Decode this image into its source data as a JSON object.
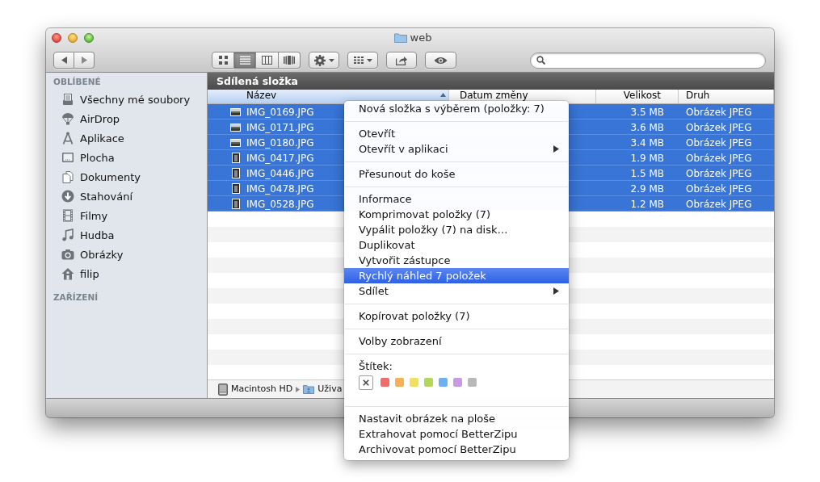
{
  "window": {
    "title": "web"
  },
  "toolbar": {
    "view_modes": [
      {
        "kind": "icons",
        "selected": false
      },
      {
        "kind": "list",
        "selected": true
      },
      {
        "kind": "columns",
        "selected": false
      },
      {
        "kind": "coverflow",
        "selected": false
      }
    ]
  },
  "sidebar": {
    "sections": [
      {
        "heading": "OBLÍBENÉ",
        "items": [
          {
            "kind": "allfiles",
            "label": "Všechny mé soubory",
            "selected": false
          },
          {
            "kind": "airdrop",
            "label": "AirDrop",
            "selected": false
          },
          {
            "kind": "apps",
            "label": "Aplikace",
            "selected": false
          },
          {
            "kind": "desktop",
            "label": "Plocha",
            "selected": false
          },
          {
            "kind": "documents",
            "label": "Dokumenty",
            "selected": false
          },
          {
            "kind": "downloads",
            "label": "Stahování",
            "selected": false
          },
          {
            "kind": "movies",
            "label": "Filmy",
            "selected": false
          },
          {
            "kind": "music",
            "label": "Hudba",
            "selected": false
          },
          {
            "kind": "pictures",
            "label": "Obrázky",
            "selected": false
          },
          {
            "kind": "home",
            "label": "filip",
            "selected": false
          }
        ]
      },
      {
        "heading": "ZAŘÍZENÍ"
      }
    ]
  },
  "browser": {
    "title": "Sdílená složka",
    "columns": [
      {
        "label": "Název",
        "sorted": true
      },
      {
        "label": "Datum změny",
        "sorted": false
      },
      {
        "label": "Velikost",
        "sorted": false
      },
      {
        "label": "Druh",
        "sorted": false
      }
    ],
    "rows": [
      {
        "kind": "landscape",
        "name": "IMG_0169.JPG",
        "size": "3.5 MB",
        "type": "Obrázek JPEG",
        "selected": true
      },
      {
        "kind": "landscape",
        "name": "IMG_0171.JPG",
        "size": "3.6 MB",
        "type": "Obrázek JPEG",
        "selected": true
      },
      {
        "kind": "landscape",
        "name": "IMG_0180.JPG",
        "size": "3.4 MB",
        "type": "Obrázek JPEG",
        "selected": true
      },
      {
        "kind": "portrait",
        "name": "IMG_0417.JPG",
        "size": "1.9 MB",
        "type": "Obrázek JPEG",
        "selected": true
      },
      {
        "kind": "portrait",
        "name": "IMG_0446.JPG",
        "size": "1.5 MB",
        "type": "Obrázek JPEG",
        "selected": true
      },
      {
        "kind": "portrait",
        "name": "IMG_0478.JPG",
        "size": "2.9 MB",
        "type": "Obrázek JPEG",
        "selected": true
      },
      {
        "kind": "portrait",
        "name": "IMG_0528.JPG",
        "size": "1.2 MB",
        "type": "Obrázek JPEG",
        "selected": true
      }
    ],
    "path": [
      {
        "kind": "disk",
        "label": "Macintosh HD"
      },
      {
        "kind": "folder",
        "label": "Uživa"
      }
    ]
  },
  "context_menu": {
    "items": [
      {
        "kind": "item",
        "label": "Nová složka s výběrem (položky: 7)",
        "submenu": false,
        "selected": false
      },
      {
        "kind": "separator"
      },
      {
        "kind": "item",
        "label": "Otevřít",
        "submenu": false,
        "selected": false
      },
      {
        "kind": "item",
        "label": "Otevřít v aplikaci",
        "submenu": true,
        "selected": false
      },
      {
        "kind": "separator"
      },
      {
        "kind": "item",
        "label": "Přesunout do koše",
        "submenu": false,
        "selected": false
      },
      {
        "kind": "separator"
      },
      {
        "kind": "item",
        "label": "Informace",
        "submenu": false,
        "selected": false
      },
      {
        "kind": "item",
        "label": "Komprimovat položky (7)",
        "submenu": false,
        "selected": false
      },
      {
        "kind": "item",
        "label": "Vypálit položky (7) na disk…",
        "submenu": false,
        "selected": false
      },
      {
        "kind": "item",
        "label": "Duplikovat",
        "submenu": false,
        "selected": false
      },
      {
        "kind": "item",
        "label": "Vytvořit zástupce",
        "submenu": false,
        "selected": false
      },
      {
        "kind": "item",
        "label": "Rychlý náhled 7 položek",
        "submenu": false,
        "selected": true
      },
      {
        "kind": "item",
        "label": "Sdílet",
        "submenu": true,
        "selected": false
      },
      {
        "kind": "separator"
      },
      {
        "kind": "item",
        "label": "Kopírovat položky (7)",
        "submenu": false,
        "selected": false
      },
      {
        "kind": "separator"
      },
      {
        "kind": "item",
        "label": "Volby zobrazení",
        "submenu": false,
        "selected": false
      },
      {
        "kind": "separator"
      },
      {
        "kind": "labels",
        "label": "Štítek:",
        "colors": [
          {
            "kind": "none"
          },
          {
            "kind": "color",
            "color": "#f26b6b"
          },
          {
            "kind": "color",
            "color": "#f7b058"
          },
          {
            "kind": "color",
            "color": "#f1e05e"
          },
          {
            "kind": "color",
            "color": "#b5d65c"
          },
          {
            "kind": "color",
            "color": "#6eb1f2"
          },
          {
            "kind": "color",
            "color": "#c99be2"
          },
          {
            "kind": "color",
            "color": "#b9b9b9"
          }
        ]
      },
      {
        "kind": "separator"
      },
      {
        "kind": "item",
        "label": "Nastavit obrázek na ploše",
        "submenu": false,
        "selected": false
      },
      {
        "kind": "item",
        "label": "Extrahovat pomocí BetterZipu",
        "submenu": false,
        "selected": false
      },
      {
        "kind": "item",
        "label": "Archivovat pomocí BetterZipu",
        "submenu": false,
        "selected": false
      }
    ]
  }
}
